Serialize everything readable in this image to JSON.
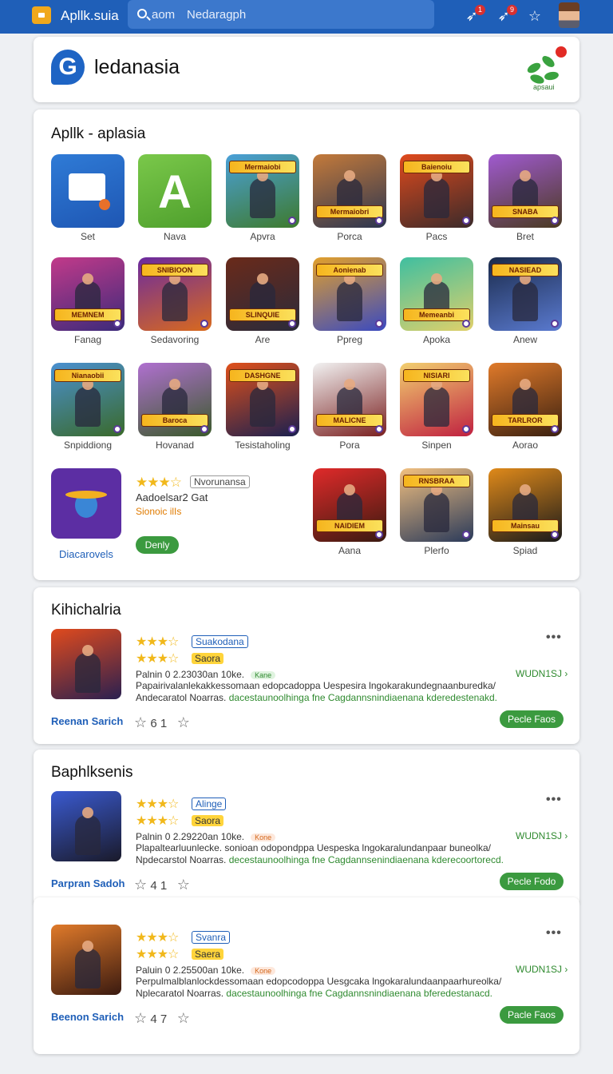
{
  "topbar": {
    "app_name": "Apllk.suia",
    "search_label": "aom",
    "search_value": "Nedaragph",
    "icons": [
      {
        "name": "notification-bell-icon",
        "badge": "1"
      },
      {
        "name": "messages-icon",
        "badge": "9"
      },
      {
        "name": "favorites-star-icon",
        "badge": ""
      }
    ]
  },
  "header": {
    "brand_name": "ledanasia",
    "plant_logo_text": "apsaui"
  },
  "apps": {
    "title": "Apllk - aplasia",
    "rows": [
      [
        {
          "label": "Set",
          "banner": "",
          "colors": [
            "#2f7bd6",
            "#1e56b3"
          ],
          "kind": "utility"
        },
        {
          "label": "Nava",
          "banner": "",
          "colors": [
            "#7ac84a",
            "#4e9f2c"
          ],
          "kind": "android"
        },
        {
          "label": "Apvra",
          "banner": "Mermaiobi",
          "colors": [
            "#4aa0d8",
            "#3e7a2c"
          ],
          "kind": "game"
        },
        {
          "label": "Porca",
          "banner": "Mermaiobri",
          "colors": [
            "#c47a3a",
            "#2b3550"
          ],
          "kind": "game"
        },
        {
          "label": "Pacs",
          "banner": "Baienoiu",
          "colors": [
            "#e04a1d",
            "#3a2a2a"
          ],
          "kind": "game"
        },
        {
          "label": "Bret",
          "banner": "SNABA",
          "colors": [
            "#a05ad0",
            "#4a3a20"
          ],
          "kind": "game"
        }
      ],
      [
        {
          "label": "Fanag",
          "banner": "MEMNEM",
          "colors": [
            "#c23a8a",
            "#3b2a7a"
          ],
          "kind": "game"
        },
        {
          "label": "Sedavoring",
          "banner": "SNIBIOON",
          "colors": [
            "#6a2aa0",
            "#d96a1d"
          ],
          "kind": "game"
        },
        {
          "label": "Are",
          "banner": "SLINQUIE",
          "colors": [
            "#6a2a1a",
            "#2b2b3a"
          ],
          "kind": "game"
        },
        {
          "label": "Ppreg",
          "banner": "Aonienab",
          "colors": [
            "#e2a02b",
            "#3a4ac0"
          ],
          "kind": "game"
        },
        {
          "label": "Apoka",
          "banner": "Memeanbi",
          "colors": [
            "#3fbfa0",
            "#e0d06a"
          ],
          "kind": "game"
        },
        {
          "label": "Anew",
          "banner": "NASIEAD",
          "colors": [
            "#1a2a4a",
            "#5a7ad0"
          ],
          "kind": "game"
        }
      ],
      [
        {
          "label": "Snpiddiong",
          "banner": "Nianaobii",
          "colors": [
            "#4a90d0",
            "#3a6a2a"
          ],
          "kind": "game"
        },
        {
          "label": "Hovanad",
          "banner": "Baroca",
          "colors": [
            "#b070d0",
            "#3a5a2a"
          ],
          "kind": "game"
        },
        {
          "label": "Tesistaholing",
          "banner": "DASHGNE",
          "colors": [
            "#e0501a",
            "#1a2050"
          ],
          "kind": "game"
        },
        {
          "label": "Pora",
          "banner": "MALICNE",
          "colors": [
            "#f2f2f2",
            "#7a2020"
          ],
          "kind": "game"
        },
        {
          "label": "Sinpen",
          "banner": "NISIARI",
          "colors": [
            "#f2d070",
            "#c02040"
          ],
          "kind": "game"
        },
        {
          "label": "Aorao",
          "banner": "TARLROR",
          "colors": [
            "#e07a2a",
            "#3a2010"
          ],
          "kind": "game"
        }
      ],
      [
        {
          "label": "Aana",
          "banner": "NAIDIEM",
          "colors": [
            "#e02a2a",
            "#3a1a10"
          ],
          "kind": "game"
        },
        {
          "label": "Plerfo",
          "banner": "RNSBRAA",
          "colors": [
            "#f2c080",
            "#2a3a5a"
          ],
          "kind": "game"
        },
        {
          "label": "Spiad",
          "banner": "Mainsau",
          "colors": [
            "#e08a1a",
            "#1a1a1a"
          ],
          "kind": "game"
        }
      ]
    ],
    "promo": {
      "name": "Diacarovels",
      "stars": "★★★☆",
      "tag": "Nvorunansa",
      "line1": "Aadoelsar2 Gat",
      "line2": "Sionoic ilIs",
      "button": "Denly"
    }
  },
  "sections": [
    {
      "title": "Kihichalria",
      "stars1": "★★★☆",
      "tag1": "Suakodana",
      "stars2": "★★★☆",
      "tag2": "Saora",
      "meta": "Palnin 0 2.23030an 10ke.",
      "pill": "Kane",
      "desc1": "Papairivalanlekakkessomaan edopcadoppa Uespesira lngokarakundegnaanburedka/",
      "desc2a": "Andecaratol Noarras. ",
      "desc2b": "dacestaunoolhinga fne Cagdannsnindiaenana kderedestenakd.",
      "side_link": "WUDN1SJ ›",
      "reviewer": "Reenan Sarich",
      "rating": "6 1",
      "button": "Pecle Faos"
    },
    {
      "title": "Baphlksenis",
      "stars1": "★★★☆",
      "tag1": "Alinge",
      "stars2": "★★★☆",
      "tag2": "Saora",
      "meta": "Palnin 0 2.29220an 10ke.",
      "pill": "Kone",
      "desc1": "Plapaltearluunlecke. sonioan odopondppa Uespeska lngokaralundanpaar buneolka/",
      "desc2a": "Npdecarstol Noarras. ",
      "desc2b": "decestaunoolhinga fne Cagdannsenindiaenana kderecoortorecd.",
      "side_link": "WUDN1SJ ›",
      "reviewer": "Parpran Sadoh",
      "rating": "4 1",
      "button": "Pecle Fodo"
    },
    {
      "title": "",
      "stars1": "★★★☆",
      "tag1": "Svanra",
      "stars2": "★★★☆",
      "tag2": "Saera",
      "meta": "Paluin 0 2.25500an 10ke.",
      "pill": "Kone",
      "desc1": "Perpulmalblanlockdessomaan edopcodoppa Uesgcaka lngokaralundaanpaarhureolka/",
      "desc2a": "Nplecaratol Noarras. ",
      "desc2b": "dacestaunoolhinga fne Cagdannsnindiaenana bferedestanacd.",
      "side_link": "WUDN1SJ ›",
      "reviewer": "Beenon Sarich",
      "rating": "4 7",
      "button": "Pacle Faos"
    }
  ]
}
